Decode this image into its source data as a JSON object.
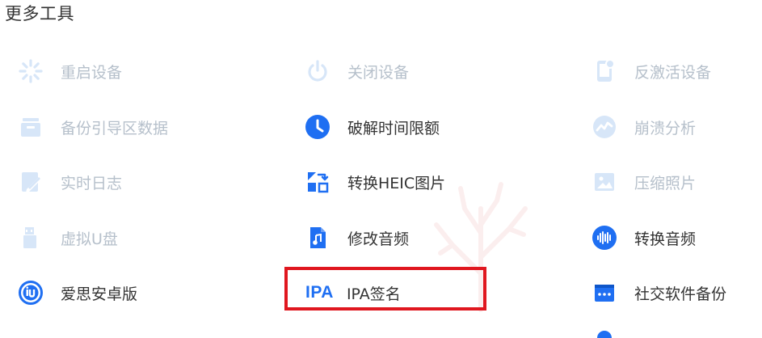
{
  "section": {
    "title": "更多工具"
  },
  "tools": {
    "reboot": "重启设备",
    "shutdown": "关闭设备",
    "deactivate": "反激活设备",
    "backup_boot": "备份引导区数据",
    "crack_time": "破解时间限额",
    "crash_analysis": "崩溃分析",
    "realtime_log": "实时日志",
    "convert_heic": "转换HEIC图片",
    "compress_photo": "压缩照片",
    "virtual_u_disk": "虚拟U盘",
    "edit_audio": "修改音频",
    "convert_audio": "转换音频",
    "aisi_android": "爱思安卓版",
    "ipa_sign": "IPA签名",
    "social_backup": "社交软件备份"
  },
  "icon_text": {
    "ipa": "IPA"
  },
  "colors": {
    "accent": "#1f6ff2",
    "disabled_icon": "#d7e6f8",
    "disabled_text": "#b6c0cb",
    "enabled_text": "#333333",
    "highlight": "#e0171f"
  },
  "icons": {
    "reboot": "spinner-icon",
    "shutdown": "power-icon",
    "deactivate": "phone-deactivate-icon",
    "backup_boot": "archive-box-icon",
    "crack_time": "clock-icon",
    "crash_analysis": "crash-chart-icon",
    "realtime_log": "log-pen-icon",
    "convert_heic": "image-convert-icon",
    "compress_photo": "photo-icon",
    "virtual_u_disk": "usb-drive-icon",
    "edit_audio": "audio-file-icon",
    "convert_audio": "audio-wave-icon",
    "aisi_android": "aisi-logo-icon",
    "ipa_sign": "ipa-text-icon",
    "social_backup": "chat-backup-icon"
  }
}
